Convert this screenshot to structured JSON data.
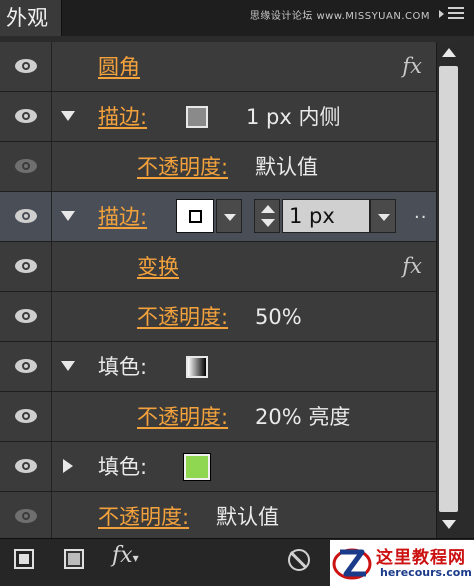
{
  "panel": {
    "tab_title": "外观",
    "watermark": "思缘设计论坛 www.MISSYUAN.COM"
  },
  "rows": [
    {
      "label": "圆角",
      "fx": "fx"
    },
    {
      "label": "描边:",
      "value": "1 px  内侧",
      "swatch_color": "#8a8a8a"
    },
    {
      "label": "不透明度:",
      "value": "默认值"
    },
    {
      "label": "描边:",
      "stroke_weight": "1 px",
      "more": "..",
      "selected": true
    },
    {
      "label": "变换",
      "fx": "fx"
    },
    {
      "label": "不透明度:",
      "value": "50%"
    },
    {
      "label": "填色:",
      "swatch": "gradient"
    },
    {
      "label": "不透明度:",
      "value": "20% 亮度"
    },
    {
      "label": "填色:",
      "swatch_color": "#8fd651"
    },
    {
      "label": "不透明度:",
      "value": "默认值"
    }
  ],
  "toolbar": {
    "fx_label": "fx"
  },
  "logo": {
    "title": "这里教程网",
    "url": "herecours.com"
  },
  "colors": {
    "accent_link": "#f4a23c",
    "selected_row": "#4a4e56",
    "logo_red": "#cc1111"
  },
  "icons": {
    "eye": "eye-icon",
    "disclosure_open": "triangle-down-icon",
    "disclosure_closed": "triangle-right-icon",
    "menu": "panel-menu-icon",
    "clear": "clear-appearance-icon"
  }
}
